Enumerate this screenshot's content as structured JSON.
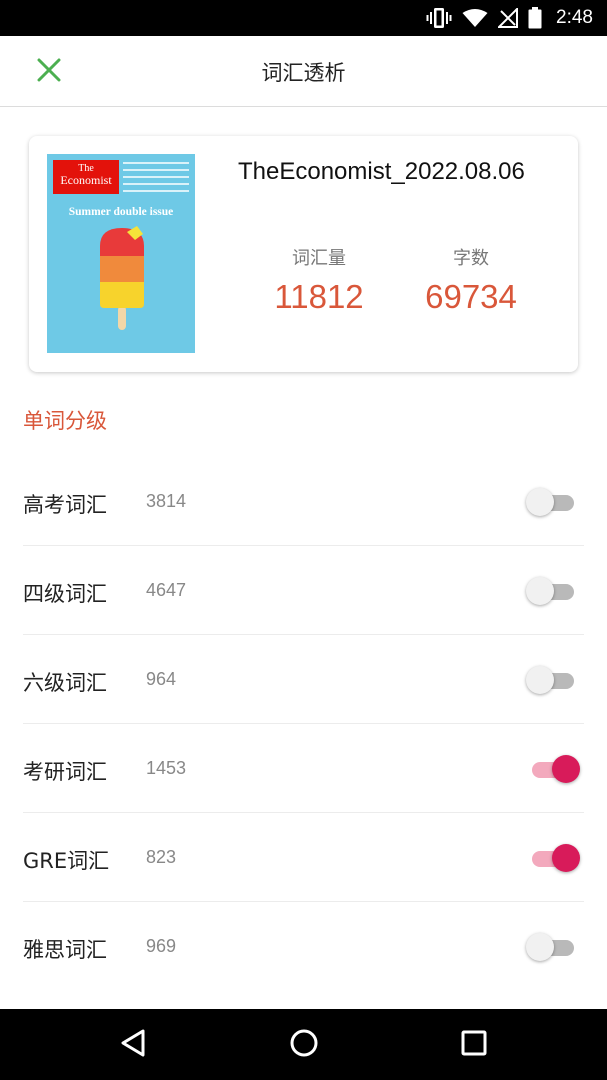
{
  "status_bar": {
    "time": "2:48",
    "icons": [
      "vibrate-icon",
      "wifi-icon",
      "signal-icon",
      "battery-icon"
    ]
  },
  "header": {
    "title": "词汇透析",
    "close_icon": "close-icon",
    "accent_color": "#4caf50"
  },
  "book": {
    "title": "TheEconomist_2022.08.06",
    "cover": {
      "logo_line1": "The",
      "logo_line2": "Economist",
      "headline": "Summer double issue"
    },
    "stats": [
      {
        "label": "词汇量",
        "value": "11812"
      },
      {
        "label": "字数",
        "value": "69734"
      }
    ],
    "value_color": "#d9573a"
  },
  "section": {
    "title": "单词分级"
  },
  "levels": [
    {
      "name": "高考词汇",
      "count": "3814",
      "enabled": false
    },
    {
      "name": "四级词汇",
      "count": "4647",
      "enabled": false
    },
    {
      "name": "六级词汇",
      "count": "964",
      "enabled": false
    },
    {
      "name": "考研词汇",
      "count": "1453",
      "enabled": true
    },
    {
      "name": "GRE词汇",
      "count": "823",
      "enabled": true
    },
    {
      "name": "雅思词汇",
      "count": "969",
      "enabled": false
    }
  ],
  "switch_colors": {
    "on_thumb": "#d81b5a",
    "on_track": "#f3a9bd",
    "off_thumb": "#f1f1f1",
    "off_track": "#b9b9b9"
  },
  "nav_bar": {
    "icons": [
      "back-icon",
      "home-icon",
      "recents-icon"
    ]
  }
}
